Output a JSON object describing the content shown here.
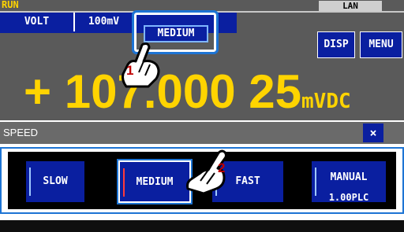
{
  "status": {
    "run": "RUN",
    "lan": "LAN"
  },
  "function_row": {
    "volt": "VOLT",
    "range": "100mV",
    "speed": "MEDIUM"
  },
  "buttons": {
    "disp": "DISP",
    "menu": "MENU"
  },
  "reading": {
    "value": "+ 107.000 25",
    "unit": "mVDC"
  },
  "speed_dialog": {
    "title": "SPEED",
    "close": "×",
    "options": [
      "SLOW",
      "MEDIUM",
      "FAST",
      "MANUAL"
    ],
    "selected": "MEDIUM",
    "manual_setting": "1.00PLC"
  },
  "callouts": [
    "1",
    "2"
  ],
  "colors": {
    "reading": "#ffd400",
    "button": "#0a1fa0",
    "highlight": "#1d74d4",
    "selected_bar": "#ff3a3a"
  }
}
